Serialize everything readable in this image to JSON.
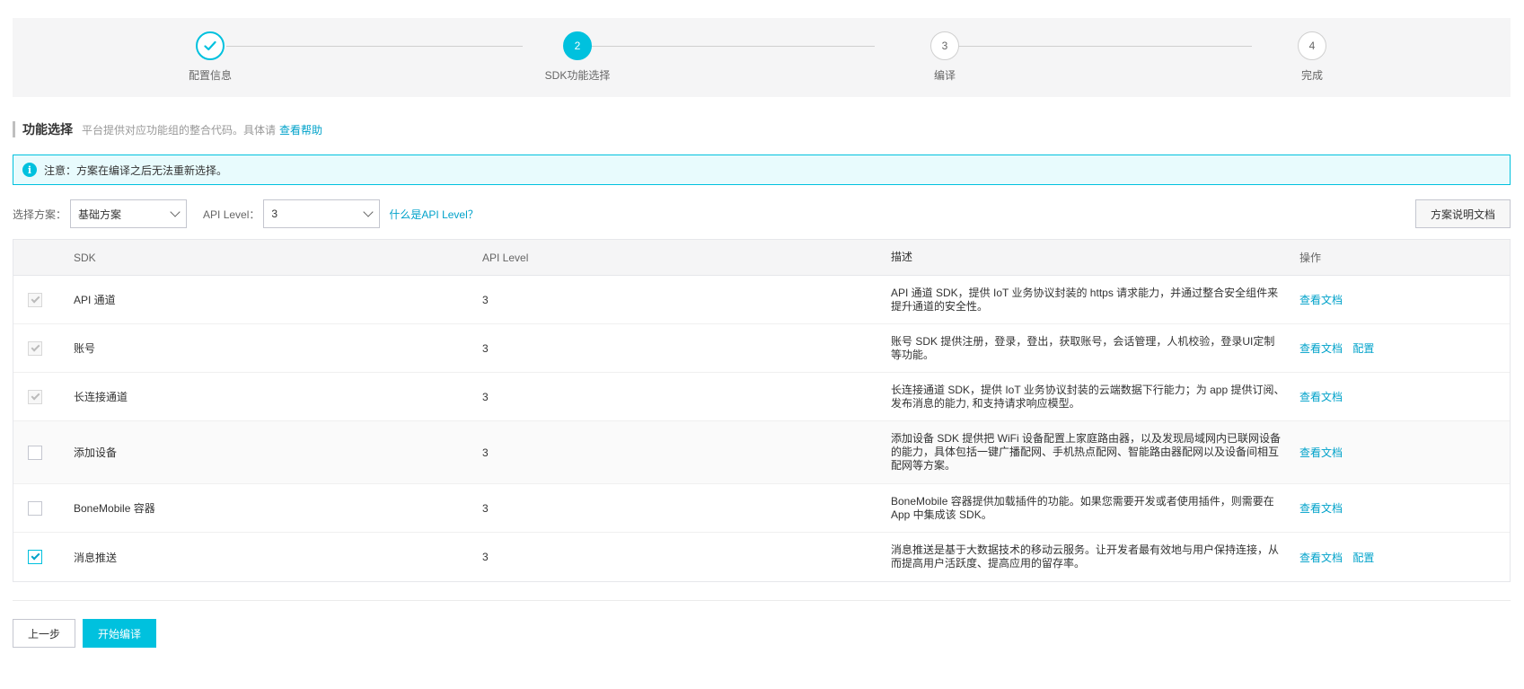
{
  "stepper": {
    "steps": [
      {
        "num": "",
        "label": "配置信息",
        "state": "done"
      },
      {
        "num": "2",
        "label": "SDK功能选择",
        "state": "active"
      },
      {
        "num": "3",
        "label": "编译",
        "state": "pending"
      },
      {
        "num": "4",
        "label": "完成",
        "state": "pending"
      }
    ]
  },
  "section": {
    "title": "功能选择",
    "desc": "平台提供对应功能组的整合代码。具体请",
    "help_link": "查看帮助"
  },
  "notice": {
    "icon": "info-icon",
    "icon_glyph": "i",
    "text": "注意：方案在编译之后无法重新选择。"
  },
  "filters": {
    "plan_label": "选择方案：",
    "plan_value": "基础方案",
    "api_label": "API Level：",
    "api_value": "3",
    "api_help_link": "什么是API Level？",
    "doc_button": "方案说明文档"
  },
  "table": {
    "headers": {
      "sdk": "SDK",
      "api": "API Level",
      "desc": "描述",
      "ops": "操作"
    },
    "rows": [
      {
        "checked": true,
        "disabled": true,
        "sdk": "API 通道",
        "api": "3",
        "desc": "API 通道 SDK，提供 IoT 业务协议封装的 https 请求能力，并通过整合安全组件来提升通道的安全性。",
        "ops": [
          "查看文档"
        ]
      },
      {
        "checked": true,
        "disabled": true,
        "sdk": "账号",
        "api": "3",
        "desc": "账号 SDK 提供注册，登录，登出，获取账号，会话管理，人机校验，登录UI定制等功能。",
        "ops": [
          "查看文档",
          "配置"
        ]
      },
      {
        "checked": true,
        "disabled": true,
        "sdk": "长连接通道",
        "api": "3",
        "desc": "长连接通道 SDK，提供 IoT 业务协议封装的云端数据下行能力；为 app 提供订阅、发布消息的能力, 和支持请求响应模型。",
        "ops": [
          "查看文档"
        ]
      },
      {
        "checked": false,
        "disabled": false,
        "sdk": "添加设备",
        "api": "3",
        "desc": "添加设备 SDK 提供把 WiFi 设备配置上家庭路由器，以及发现局域网内已联网设备的能力，具体包括一键广播配网、手机热点配网、智能路由器配网以及设备间相互配网等方案。",
        "ops": [
          "查看文档"
        ]
      },
      {
        "checked": false,
        "disabled": false,
        "sdk": "BoneMobile 容器",
        "api": "3",
        "desc": "BoneMobile 容器提供加载插件的功能。如果您需要开发或者使用插件，则需要在 App 中集成该 SDK。",
        "ops": [
          "查看文档"
        ]
      },
      {
        "checked": true,
        "disabled": false,
        "sdk": "消息推送",
        "api": "3",
        "desc": "消息推送是基于大数据技术的移动云服务。让开发者最有效地与用户保持连接，从而提高用户活跃度、提高应用的留存率。",
        "ops": [
          "查看文档",
          "配置"
        ]
      }
    ]
  },
  "footer": {
    "prev_button": "上一步",
    "start_button": "开始编译"
  },
  "colors": {
    "accent": "#00c1de",
    "link": "#00a2ca"
  }
}
